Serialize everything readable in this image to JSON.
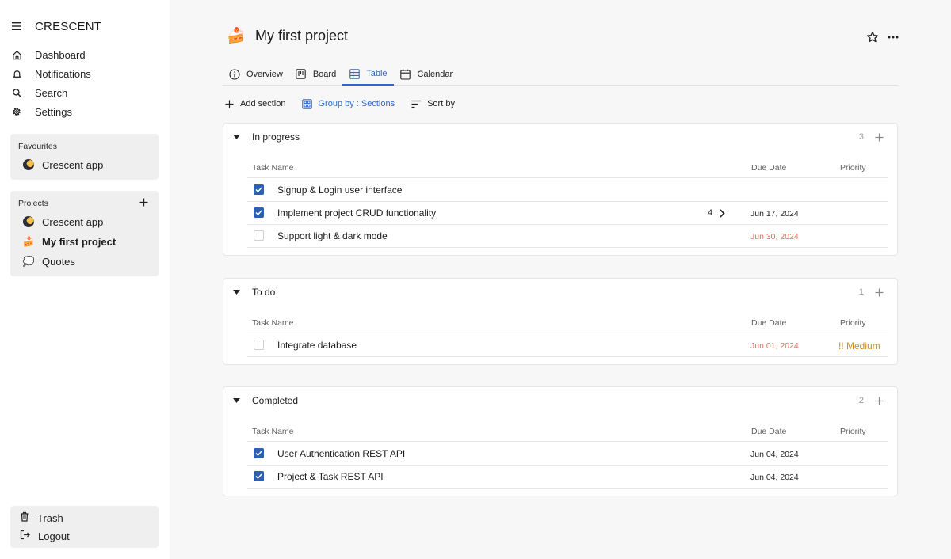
{
  "app": {
    "name": "CRESCENT"
  },
  "nav": [
    {
      "label": "Dashboard",
      "icon": "home-icon"
    },
    {
      "label": "Notifications",
      "icon": "bell-icon"
    },
    {
      "label": "Search",
      "icon": "search-icon"
    },
    {
      "label": "Settings",
      "icon": "gear-icon"
    }
  ],
  "favourites": {
    "title": "Favourites",
    "items": [
      {
        "label": "Crescent app",
        "icon": "moon-icon"
      }
    ]
  },
  "projects": {
    "title": "Projects",
    "items": [
      {
        "label": "Crescent app",
        "icon": "moon-icon"
      },
      {
        "label": "My first project",
        "icon": "cake-icon",
        "emoji": "🍰",
        "active": true
      },
      {
        "label": "Quotes",
        "icon": "speech-bubble-icon",
        "emoji": "💭"
      }
    ]
  },
  "bottom": {
    "trash": "Trash",
    "logout": "Logout"
  },
  "header": {
    "emoji": "🍰",
    "title": "My first project"
  },
  "tabs": [
    {
      "label": "Overview",
      "icon": "info-icon"
    },
    {
      "label": "Board",
      "icon": "board-icon"
    },
    {
      "label": "Table",
      "icon": "table-icon",
      "active": true
    },
    {
      "label": "Calendar",
      "icon": "calendar-icon"
    }
  ],
  "toolbar": {
    "add_section": "Add section",
    "group_by": "Group by : Sections",
    "sort_by": "Sort by"
  },
  "columns": {
    "name": "Task Name",
    "due": "Due Date",
    "priority": "Priority"
  },
  "sections": [
    {
      "title": "In progress",
      "count": "3",
      "tasks": [
        {
          "name": "Signup & Login user interface",
          "done": true,
          "due": "",
          "priority": ""
        },
        {
          "name": "Implement project CRUD functionality",
          "done": true,
          "subtasks": "4",
          "due": "Jun 17, 2024",
          "priority": ""
        },
        {
          "name": "Support light & dark mode",
          "done": false,
          "due": "Jun 30, 2024",
          "overdue": true,
          "priority": ""
        }
      ]
    },
    {
      "title": "To do",
      "count": "1",
      "tasks": [
        {
          "name": "Integrate database",
          "done": false,
          "due": "Jun 01, 2024",
          "overdue": true,
          "priority": "!! Medium"
        }
      ]
    },
    {
      "title": "Completed",
      "count": "2",
      "tasks": [
        {
          "name": "User Authentication REST API",
          "done": true,
          "due": "Jun 04, 2024",
          "priority": ""
        },
        {
          "name": "Project & Task REST API",
          "done": true,
          "due": "Jun 04, 2024",
          "priority": ""
        }
      ]
    }
  ],
  "colors": {
    "accent": "#2e67c6",
    "checkbox": "#2e5fb1",
    "overdue": "#e06c5a",
    "medium": "#d48c12"
  }
}
